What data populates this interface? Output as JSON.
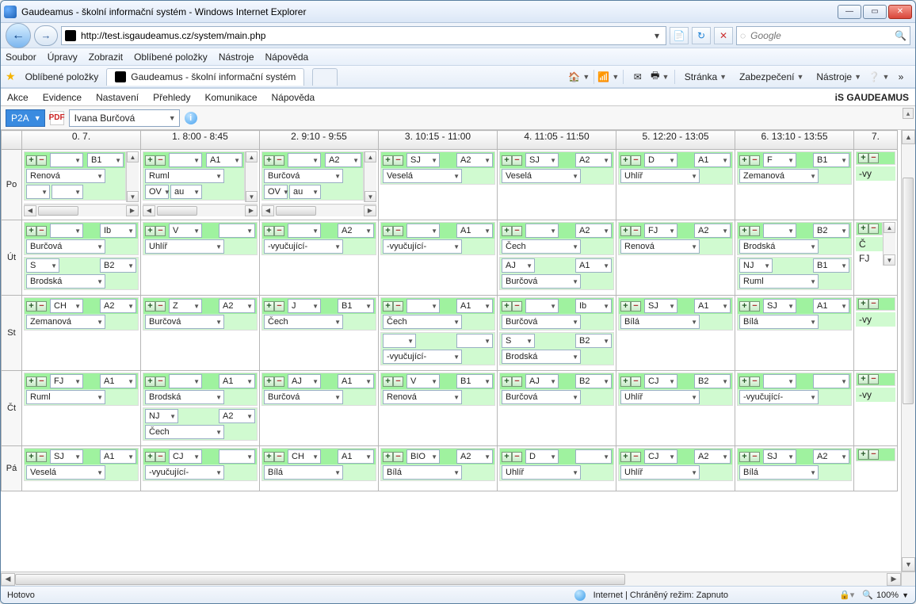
{
  "window": {
    "title": "Gaudeamus - školní informační systém - Windows Internet Explorer",
    "url": "http://test.isgaudeamus.cz/system/main.php",
    "search_placeholder": "Google",
    "status_left": "Hotovo",
    "status_zone": "Internet | Chráněný režim: Zapnuto",
    "zoom": "100%"
  },
  "ie_menu": [
    "Soubor",
    "Úpravy",
    "Zobrazit",
    "Oblíbené položky",
    "Nástroje",
    "Nápověda"
  ],
  "favorites_label": "Oblíbené položky",
  "tab_title": "Gaudeamus - školní informační systém",
  "cmdbar": {
    "page": "Stránka",
    "safety": "Zabezpečení",
    "tools": "Nástroje"
  },
  "app_menu": [
    "Akce",
    "Evidence",
    "Nastavení",
    "Přehledy",
    "Komunikace",
    "Nápověda"
  ],
  "brand": "iS GAUDEAMUS",
  "toolbar": {
    "class": "P2A",
    "teacher": "Ivana Burčová"
  },
  "periods": [
    "0. 7.",
    "1. 8:00 - 8:45",
    "2. 9:10 - 9:55",
    "3. 10:15 - 11:00",
    "4. 11:05 - 11:50",
    "5. 12:20 - 13:05",
    "6. 13:10 - 13:55",
    "7."
  ],
  "days": [
    "Po",
    "Út",
    "St",
    "Čt",
    "Pá"
  ],
  "schedule": {
    "Po": [
      {
        "lessons": [
          {
            "subj": "",
            "room": "B1",
            "teacher": "Renová",
            "r2s": "",
            "r2r": ""
          }
        ],
        "hscroll": true,
        "vscroll": true
      },
      {
        "lessons": [
          {
            "subj": "",
            "room": "A1",
            "teacher": "Ruml",
            "r2s": "OV",
            "r2r": "au"
          }
        ],
        "hscroll": true,
        "vscroll": true
      },
      {
        "lessons": [
          {
            "subj": "",
            "room": "A2",
            "teacher": "Burčová",
            "r2s": "OV",
            "r2r": "au"
          }
        ],
        "hscroll": true,
        "vscroll": true
      },
      {
        "lessons": [
          {
            "subj": "SJ",
            "room": "A2",
            "teacher": "Veselá"
          }
        ]
      },
      {
        "lessons": [
          {
            "subj": "SJ",
            "room": "A2",
            "teacher": "Veselá"
          }
        ]
      },
      {
        "lessons": [
          {
            "subj": "D",
            "room": "A1",
            "teacher": "Uhlíř"
          }
        ]
      },
      {
        "lessons": [
          {
            "subj": "F",
            "room": "B1",
            "teacher": "Zemanová"
          }
        ]
      },
      {
        "lessons": [
          {
            "pmOnly": true
          }
        ],
        "trail": "-vy"
      }
    ],
    "Út": [
      {
        "lessons": [
          {
            "subj": "",
            "room": "Ib",
            "teacher": "Burčová"
          },
          {
            "subj2": "S",
            "room": "B2",
            "teacher": "Brodská",
            "pale": true
          }
        ]
      },
      {
        "lessons": [
          {
            "subj": "V",
            "room": "",
            "teacher": "Uhlíř"
          }
        ]
      },
      {
        "lessons": [
          {
            "subj": "",
            "room": "A2",
            "teacher": "-vyučující-"
          }
        ]
      },
      {
        "lessons": [
          {
            "subj": "",
            "room": "A1",
            "teacher": "-vyučující-"
          }
        ]
      },
      {
        "lessons": [
          {
            "subj": "",
            "room": "A2",
            "teacher": "Čech"
          },
          {
            "subj2": "AJ",
            "room": "A1",
            "teacher": "Burčová",
            "pale": true
          }
        ]
      },
      {
        "lessons": [
          {
            "subj": "FJ",
            "room": "A2",
            "teacher": "Renová"
          }
        ]
      },
      {
        "lessons": [
          {
            "subj": "",
            "room": "B2",
            "teacher": "Brodská"
          },
          {
            "subj2": "NJ",
            "room": "B1",
            "teacher": "Ruml",
            "pale": true
          }
        ]
      },
      {
        "lessons": [
          {
            "pmOnly": true
          }
        ],
        "trail": "Č",
        "extra": "FJ",
        "vscroll": true
      }
    ],
    "St": [
      {
        "lessons": [
          {
            "subj": "CH",
            "room": "A2",
            "teacher": "Zemanová"
          }
        ]
      },
      {
        "lessons": [
          {
            "subj": "Z",
            "room": "A2",
            "teacher": "Burčová"
          }
        ]
      },
      {
        "lessons": [
          {
            "subj": "J",
            "room": "B1",
            "teacher": "Čech"
          }
        ]
      },
      {
        "lessons": [
          {
            "subj": "",
            "room": "A1",
            "teacher": "Čech"
          },
          {
            "subj2": "",
            "room": "",
            "teacher": "-vyučující-",
            "pale": true
          }
        ]
      },
      {
        "lessons": [
          {
            "subj": "",
            "room": "Ib",
            "teacher": "Burčová"
          },
          {
            "subj2": "S",
            "room": "B2",
            "teacher": "Brodská",
            "pale": true
          }
        ]
      },
      {
        "lessons": [
          {
            "subj": "SJ",
            "room": "A1",
            "teacher": "Bílá"
          }
        ]
      },
      {
        "lessons": [
          {
            "subj": "SJ",
            "room": "A1",
            "teacher": "Bílá"
          }
        ]
      },
      {
        "lessons": [
          {
            "pmOnly": true
          }
        ],
        "trail": "-vy"
      }
    ],
    "Čt": [
      {
        "lessons": [
          {
            "subj": "FJ",
            "room": "A1",
            "teacher": "Ruml"
          }
        ]
      },
      {
        "lessons": [
          {
            "subj": "",
            "room": "A1",
            "teacher": "Brodská"
          },
          {
            "subj2": "NJ",
            "room": "A2",
            "teacher": "Čech",
            "pale": true
          }
        ]
      },
      {
        "lessons": [
          {
            "subj": "AJ",
            "room": "A1",
            "teacher": "Burčová"
          }
        ]
      },
      {
        "lessons": [
          {
            "subj": "V",
            "room": "B1",
            "teacher": "Renová"
          }
        ]
      },
      {
        "lessons": [
          {
            "subj": "AJ",
            "room": "B2",
            "teacher": "Burčová"
          }
        ]
      },
      {
        "lessons": [
          {
            "subj": "CJ",
            "room": "B2",
            "teacher": "Uhlíř"
          }
        ]
      },
      {
        "lessons": [
          {
            "subj": "",
            "room": "",
            "teacher": "-vyučující-"
          }
        ]
      },
      {
        "lessons": [
          {
            "pmOnly": true
          }
        ],
        "trail": "-vy"
      }
    ],
    "Pá": [
      {
        "lessons": [
          {
            "subj": "SJ",
            "room": "A1",
            "teacher": "Veselá"
          }
        ]
      },
      {
        "lessons": [
          {
            "subj": "CJ",
            "room": "",
            "teacher": "-vyučující-"
          }
        ]
      },
      {
        "lessons": [
          {
            "subj": "CH",
            "room": "A1",
            "teacher": "Bílá"
          }
        ]
      },
      {
        "lessons": [
          {
            "subj": "BIO",
            "room": "A2",
            "teacher": "Bílá"
          }
        ]
      },
      {
        "lessons": [
          {
            "subj": "D",
            "room": "",
            "teacher": "Uhlíř"
          }
        ]
      },
      {
        "lessons": [
          {
            "subj": "CJ",
            "room": "A2",
            "teacher": "Uhlíř"
          }
        ]
      },
      {
        "lessons": [
          {
            "subj": "SJ",
            "room": "A2",
            "teacher": "Bílá"
          }
        ]
      },
      {
        "lessons": [
          {
            "pmOnly": true
          }
        ]
      }
    ]
  }
}
